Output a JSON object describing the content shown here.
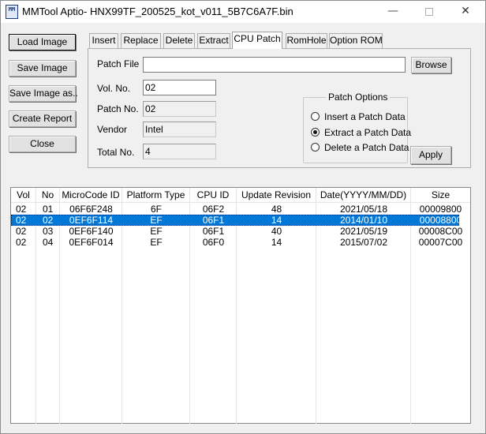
{
  "window": {
    "title": "MMTool Aptio- HNX99TF_200525_kot_v011_5B7C6A7F.bin",
    "icon_text": "MM",
    "minimize_glyph": "—",
    "close_glyph": "✕"
  },
  "left_buttons": {
    "load": "Load Image",
    "save": "Save Image",
    "save_as": "Save Image as..",
    "report": "Create Report",
    "close": "Close"
  },
  "tabs": [
    "Insert",
    "Replace",
    "Delete",
    "Extract",
    "CPU Patch",
    "RomHole",
    "Option ROM"
  ],
  "active_tab": "CPU Patch",
  "patch": {
    "patch_file_label": "Patch File",
    "patch_file_value": "",
    "browse_label": "Browse",
    "vol_no_label": "Vol. No.",
    "vol_no_value": "02",
    "patch_no_label": "Patch No.",
    "patch_no_value": "02",
    "vendor_label": "Vendor",
    "vendor_value": "Intel",
    "total_no_label": "Total No.",
    "total_no_value": "4",
    "apply_label": "Apply"
  },
  "patch_options": {
    "title": "Patch Options",
    "options": [
      "Insert a Patch Data",
      "Extract a Patch Data",
      "Delete a Patch Data"
    ],
    "selected": "Extract a Patch Data"
  },
  "table": {
    "columns": [
      "Vol",
      "No",
      "MicroCode ID",
      "Platform Type",
      "CPU ID",
      "Update Revision",
      "Date(YYYY/MM/DD)",
      "Size"
    ],
    "rows": [
      [
        "02",
        "01",
        "06F6F248",
        "6F",
        "06F2",
        "48",
        "2021/05/18",
        "00009800"
      ],
      [
        "02",
        "02",
        "0EF6F114",
        "EF",
        "06F1",
        "14",
        "2014/01/10",
        "00008800"
      ],
      [
        "02",
        "03",
        "0EF6F140",
        "EF",
        "06F1",
        "40",
        "2021/05/19",
        "00008C00"
      ],
      [
        "02",
        "04",
        "0EF6F014",
        "EF",
        "06F0",
        "14",
        "2015/07/02",
        "00007C00"
      ]
    ],
    "selected_row": 1
  }
}
